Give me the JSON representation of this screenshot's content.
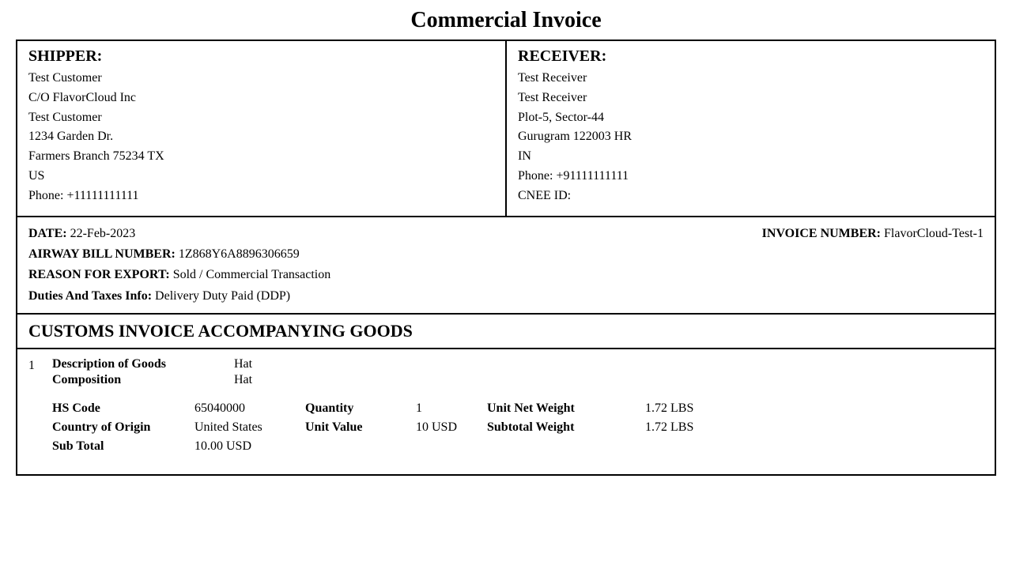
{
  "title": "Commercial Invoice",
  "shipper": {
    "label": "SHIPPER:",
    "lines": [
      "Test Customer",
      "C/O FlavorCloud Inc",
      "Test Customer",
      "1234 Garden Dr.",
      "Farmers Branch 75234 TX",
      "US",
      "Phone: +11111111111"
    ]
  },
  "receiver": {
    "label": "RECEIVER:",
    "lines": [
      "Test Receiver",
      "Test Receiver",
      "Plot-5, Sector-44",
      "Gurugram 122003 HR",
      "IN",
      "Phone: +91111111111",
      "CNEE ID:"
    ]
  },
  "info": {
    "date_label": "DATE:",
    "date_value": "22-Feb-2023",
    "invoice_number_label": "INVOICE NUMBER:",
    "invoice_number_value": "FlavorCloud-Test-1",
    "airway_label": "AIRWAY BILL NUMBER:",
    "airway_value": "1Z868Y6A8896306659",
    "reason_label": "REASON FOR EXPORT:",
    "reason_value": "Sold / Commercial Transaction",
    "duties_label": "Duties And Taxes Info:",
    "duties_value": "Delivery Duty Paid (DDP)"
  },
  "customs": {
    "header": "CUSTOMS INVOICE ACCOMPANYING GOODS"
  },
  "goods": [
    {
      "number": "1",
      "description_label": "Description of Goods",
      "description_value": "Hat",
      "composition_label": "Composition",
      "composition_value": "Hat",
      "hs_code_label": "HS Code",
      "hs_code_value": "65040000",
      "quantity_label": "Quantity",
      "quantity_value": "1",
      "unit_net_weight_label": "Unit Net Weight",
      "unit_net_weight_value": "1.72 LBS",
      "country_origin_label": "Country of Origin",
      "country_origin_value": "United States",
      "unit_value_label": "Unit Value",
      "unit_value_value": "10 USD",
      "subtotal_weight_label": "Subtotal Weight",
      "subtotal_weight_value": "1.72 LBS",
      "sub_total_label": "Sub Total",
      "sub_total_value": "10.00 USD"
    }
  ]
}
